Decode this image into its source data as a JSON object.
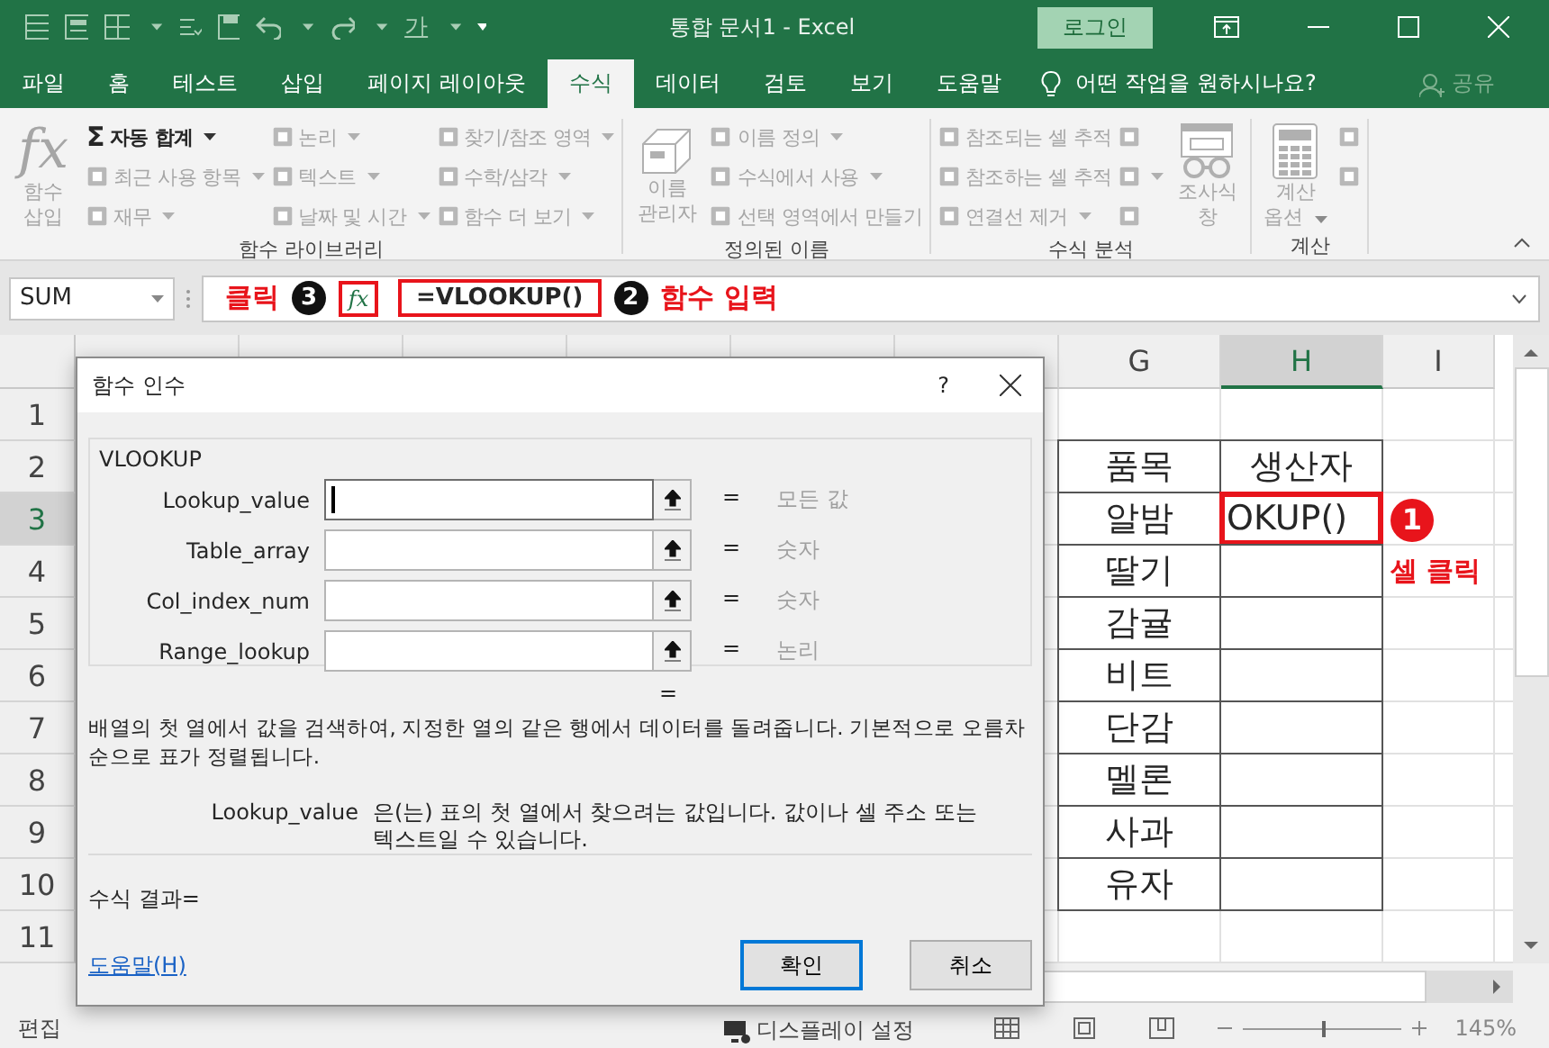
{
  "title_bar": {
    "font_color_label": "가",
    "title": "통합 문서1  -  Excel",
    "login": "로그인"
  },
  "tabs": [
    {
      "label": "파일",
      "selected": false
    },
    {
      "label": "홈",
      "selected": false
    },
    {
      "label": "테스트",
      "selected": false
    },
    {
      "label": "삽입",
      "selected": false
    },
    {
      "label": "페이지 레이아웃",
      "selected": false
    },
    {
      "label": "수식",
      "selected": true
    },
    {
      "label": "데이터",
      "selected": false
    },
    {
      "label": "검토",
      "selected": false
    },
    {
      "label": "보기",
      "selected": false
    },
    {
      "label": "도움말",
      "selected": false
    }
  ],
  "tell_me": "어떤 작업을 원하시나요?",
  "share": "공유",
  "ribbon": {
    "groups": [
      {
        "label": "함수 라이브러리",
        "sections": [
          {
            "kind": "large",
            "glyph": "fx",
            "label": "함수 삽입",
            "disabled": true,
            "dropdown": false
          },
          {
            "kind": "column",
            "items": [
              {
                "glyph": "Σ",
                "label": "자동 합계",
                "disabled": false,
                "dropdown": true
              },
              {
                "label": "최근 사용 항목",
                "disabled": true,
                "dropdown": true
              },
              {
                "label": "재무",
                "disabled": true,
                "dropdown": true
              }
            ]
          },
          {
            "kind": "column",
            "items": [
              {
                "label": "논리",
                "disabled": true,
                "dropdown": true
              },
              {
                "label": "텍스트",
                "disabled": true,
                "dropdown": true
              },
              {
                "label": "날짜 및 시간",
                "disabled": true,
                "dropdown": true
              }
            ]
          },
          {
            "kind": "column",
            "items": [
              {
                "label": "찾기/참조 영역",
                "disabled": true,
                "dropdown": true
              },
              {
                "label": "수학/삼각",
                "disabled": true,
                "dropdown": true
              },
              {
                "label": "함수 더 보기",
                "disabled": true,
                "dropdown": true
              }
            ]
          }
        ]
      },
      {
        "label": "정의된 이름",
        "sections": [
          {
            "kind": "large",
            "label": "이름 관리자",
            "disabled": true,
            "dropdown": false
          },
          {
            "kind": "column",
            "items": [
              {
                "label": "이름 정의",
                "disabled": true,
                "dropdown": true
              },
              {
                "label": "수식에서 사용",
                "disabled": true,
                "dropdown": true
              },
              {
                "label": "선택 영역에서 만들기",
                "disabled": true,
                "dropdown": false
              }
            ]
          }
        ]
      },
      {
        "label": "수식 분석",
        "sections": [
          {
            "kind": "column",
            "items": [
              {
                "label": "참조되는 셀 추적",
                "disabled": true,
                "dropdown": false
              },
              {
                "label": "참조하는 셀 추적",
                "disabled": true,
                "dropdown": false
              },
              {
                "label": "연결선 제거",
                "disabled": true,
                "dropdown": true
              }
            ]
          },
          {
            "kind": "icons",
            "items": [
              {
                "disabled": true,
                "dropdown": false
              },
              {
                "disabled": true,
                "dropdown": true
              },
              {
                "disabled": true,
                "dropdown": false
              }
            ]
          },
          {
            "kind": "large",
            "label": "조사식 창",
            "disabled": true,
            "dropdown": false
          }
        ]
      },
      {
        "label": "계산",
        "sections": [
          {
            "kind": "large",
            "label": "계산 옵션",
            "disabled": true,
            "dropdown": true
          },
          {
            "kind": "icons",
            "items": [
              {
                "disabled": true,
                "dropdown": false
              },
              {
                "disabled": true,
                "dropdown": false
              }
            ]
          }
        ]
      }
    ]
  },
  "formula_bar": {
    "name_box": "SUM",
    "click_label": "클릭",
    "step_three": "3",
    "fx": "fx",
    "formula": "=VLOOKUP()",
    "step_two": "2",
    "step_two_label": "함수 입력"
  },
  "columns": [
    {
      "label": "G",
      "selected": false
    },
    {
      "label": "H",
      "selected": true
    },
    {
      "label": "I",
      "selected": false
    }
  ],
  "rows": [
    {
      "number": "1",
      "selected": false
    },
    {
      "number": "2",
      "selected": false,
      "item": "품목",
      "producer": "생산자"
    },
    {
      "number": "3",
      "selected": true,
      "item": "알밤",
      "producer": "OKUP()",
      "badge": "1"
    },
    {
      "number": "4",
      "selected": false,
      "item": "딸기",
      "note": "셀 클릭"
    },
    {
      "number": "5",
      "selected": false,
      "item": "감귤"
    },
    {
      "number": "6",
      "selected": false,
      "item": "비트"
    },
    {
      "number": "7",
      "selected": false,
      "item": "단감"
    },
    {
      "number": "8",
      "selected": false,
      "item": "멜론"
    },
    {
      "number": "9",
      "selected": false,
      "item": "사과"
    },
    {
      "number": "10",
      "selected": false,
      "item": "유자"
    },
    {
      "number": "11",
      "selected": false
    }
  ],
  "dialog": {
    "title": "함수 인수",
    "help": "?",
    "function": "VLOOKUP",
    "args": [
      {
        "name": "Lookup_value",
        "focused": true,
        "eq": "=",
        "hint": "모든 값"
      },
      {
        "name": "Table_array",
        "focused": false,
        "eq": "=",
        "hint": "숫자"
      },
      {
        "name": "Col_index_num",
        "focused": false,
        "eq": "=",
        "hint": "숫자"
      },
      {
        "name": "Range_lookup",
        "focused": false,
        "eq": "=",
        "hint": "논리"
      }
    ],
    "result_eq": "=",
    "description": "배열의 첫 열에서 값을 검색하여, 지정한 열의 같은 행에서 데이터를 돌려줍니다. 기본적으로 오름차순으로 표가 정렬됩니다.",
    "arg_help_name": "Lookup_value",
    "arg_help": "은(는) 표의 첫 열에서 찾으려는 값입니다. 값이나 셀 주소 또는 텍스트일 수 있습니다.",
    "formula_result": "수식 결과=",
    "help_link": "도움말(H)",
    "buttons": [
      {
        "label": "확인",
        "default": true
      },
      {
        "label": "취소",
        "default": false
      }
    ]
  },
  "status_bar": {
    "mode": "편집",
    "display_settings": "디스플레이 설정",
    "zoom_slider": {
      "level": 0.5
    },
    "zoom": "145%"
  }
}
